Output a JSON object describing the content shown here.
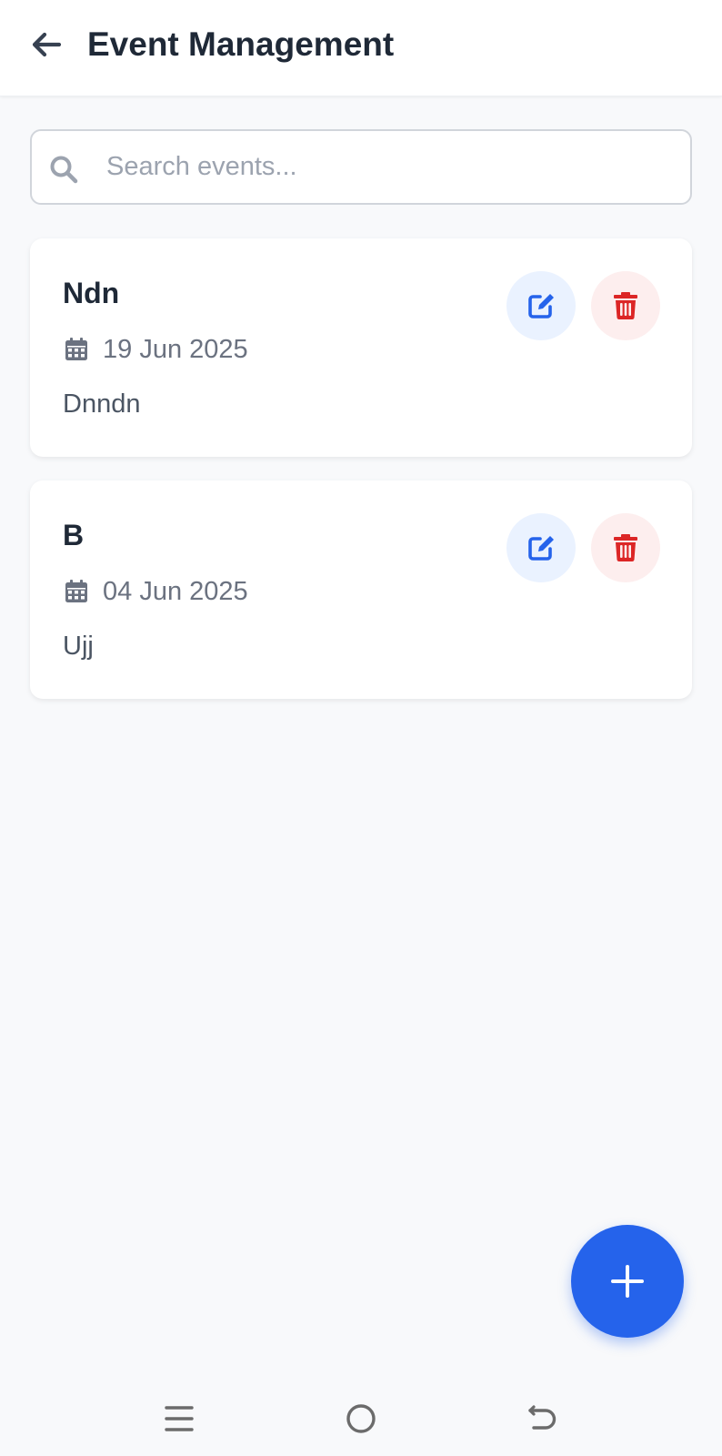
{
  "header": {
    "title": "Event Management",
    "back_icon": "arrow-left-icon"
  },
  "search": {
    "placeholder": "Search events...",
    "value": "",
    "icon": "search-icon"
  },
  "events": [
    {
      "title": "Ndn",
      "date": "19 Jun 2025",
      "description": "Dnndn"
    },
    {
      "title": "B",
      "date": "04 Jun 2025",
      "description": "Ujj"
    }
  ],
  "actions": {
    "edit_icon": "edit-icon",
    "delete_icon": "trash-icon",
    "add_icon": "plus-icon"
  },
  "colors": {
    "primary": "#2563eb",
    "danger": "#dc2626",
    "edit_bg": "#eaf2ff",
    "delete_bg": "#fdeeee",
    "page_bg": "#f8f9fb"
  },
  "navigation": {
    "items": [
      "menu-icon",
      "home-icon",
      "back-icon"
    ]
  }
}
